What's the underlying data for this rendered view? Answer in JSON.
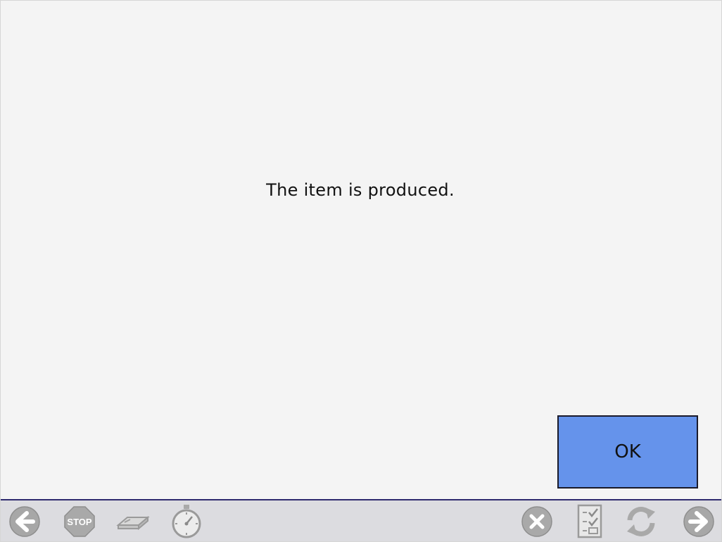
{
  "message": "The item is produced.",
  "ok_button": {
    "label": "OK"
  },
  "toolbar": {
    "left_tools": [
      {
        "name": "back-arrow-icon"
      },
      {
        "name": "stop-icon",
        "label": "STOP"
      },
      {
        "name": "eraser-icon"
      },
      {
        "name": "stopwatch-icon"
      }
    ],
    "right_tools": [
      {
        "name": "cancel-icon"
      },
      {
        "name": "checklist-icon"
      },
      {
        "name": "refresh-icon"
      },
      {
        "name": "forward-arrow-icon"
      }
    ]
  },
  "colors": {
    "background": "#f4f4f4",
    "ok_button": "#6593eb",
    "toolbar": "#dcdce0",
    "toolbar_border": "#2e2a6e",
    "icon_gray": "#a9a9a9"
  }
}
